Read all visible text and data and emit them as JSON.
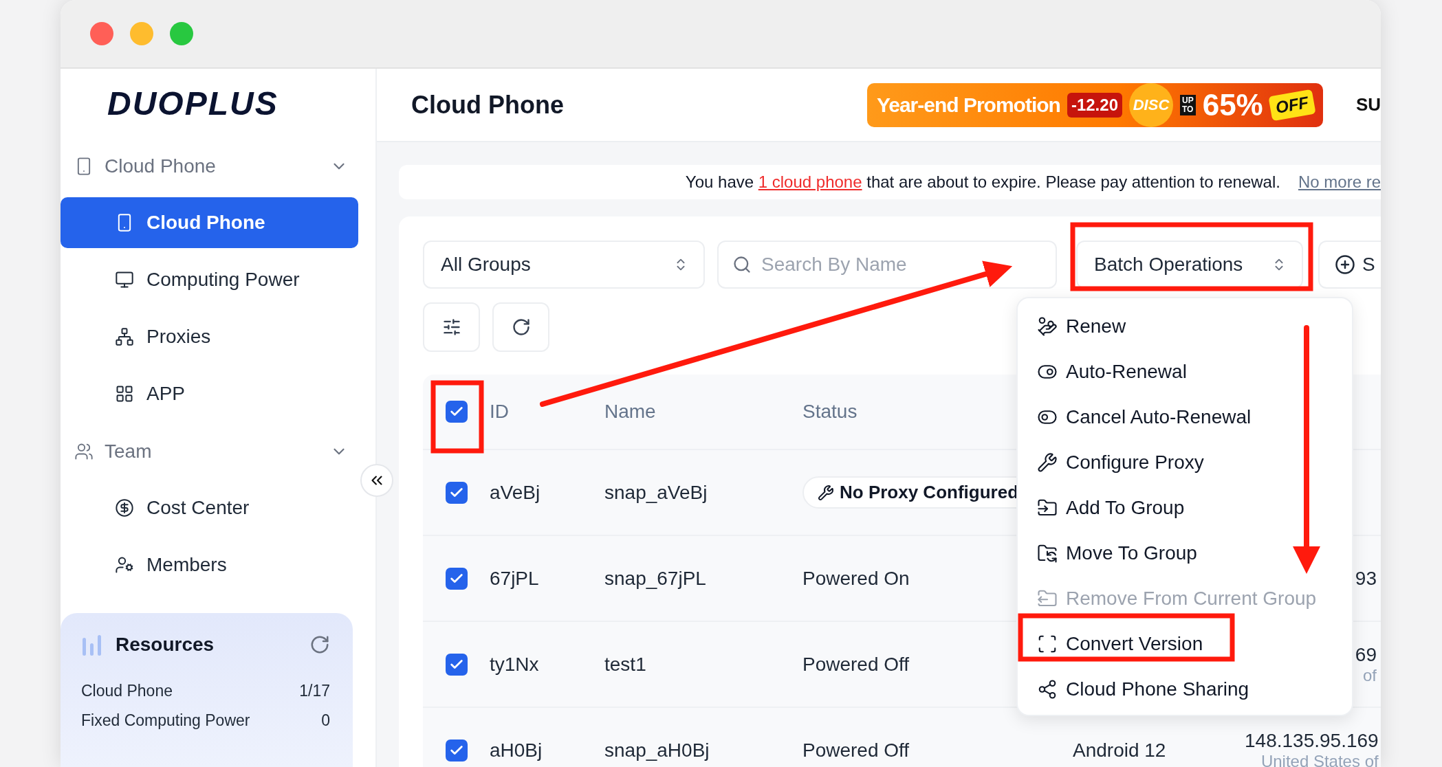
{
  "logo": "DUOPLUS",
  "sidebar": {
    "groups": [
      {
        "label": "Cloud Phone",
        "expanded": true,
        "children": [
          {
            "label": "Cloud Phone",
            "selected": true
          },
          {
            "label": "Computing Power",
            "selected": false
          },
          {
            "label": "Proxies",
            "selected": false
          },
          {
            "label": "APP",
            "selected": false
          }
        ]
      },
      {
        "label": "Team",
        "expanded": true,
        "children": [
          {
            "label": "Cost Center",
            "selected": false
          },
          {
            "label": "Members",
            "selected": false
          }
        ]
      }
    ],
    "resources": {
      "title": "Resources",
      "rows": [
        {
          "label": "Cloud Phone",
          "value": "1/17"
        },
        {
          "label": "Fixed Computing Power",
          "value": "0"
        }
      ]
    }
  },
  "header": {
    "title": "Cloud Phone",
    "promo": {
      "title": "Year-end Promotion",
      "date": "-12.20",
      "badge": "DISC",
      "up": "UP",
      "to": "TO",
      "percent": "65%",
      "off": "OFF"
    },
    "user": "SU"
  },
  "notice": {
    "before": "You have",
    "link": "1 cloud phone",
    "after": "that are about to expire. Please pay attention to renewal.",
    "dismiss": "No more re"
  },
  "toolbar": {
    "group_select": "All Groups",
    "search": {
      "placeholder": "Search By Name"
    },
    "batch": "Batch Operations",
    "add": "S"
  },
  "table": {
    "columns": [
      "ID",
      "Name",
      "Status"
    ],
    "all_checked": true,
    "rows": [
      {
        "checked": true,
        "id": "aVeBj",
        "name": "snap_aVeBj",
        "status": {
          "kind": "pill",
          "text": "No Proxy Configured"
        }
      },
      {
        "checked": true,
        "id": "67jPL",
        "name": "snap_67jPL",
        "status": {
          "kind": "text",
          "text": "Powered On"
        },
        "column_5": {
          "main": "93"
        }
      },
      {
        "checked": true,
        "id": "ty1Nx",
        "name": "test1",
        "status": {
          "kind": "text",
          "text": "Powered Off"
        },
        "column_5": {
          "main": "69",
          "sub": "of"
        }
      },
      {
        "checked": true,
        "id": "aH0Bj",
        "name": "snap_aH0Bj",
        "status": {
          "kind": "text",
          "text": "Powered Off"
        },
        "column_4": "Android 12",
        "column_5": {
          "main": "148.135.95.169",
          "sub": "United States of"
        }
      }
    ]
  },
  "batch_menu": [
    {
      "label": "Renew",
      "disabled": false
    },
    {
      "label": "Auto-Renewal",
      "disabled": false
    },
    {
      "label": "Cancel Auto-Renewal",
      "disabled": false
    },
    {
      "label": "Configure Proxy",
      "disabled": false
    },
    {
      "label": "Add To Group",
      "disabled": false
    },
    {
      "label": "Move To Group",
      "disabled": false
    },
    {
      "label": "Remove From Current Group",
      "disabled": true
    },
    {
      "label": "Convert Version",
      "disabled": false
    },
    {
      "label": "Cloud Phone Sharing",
      "disabled": false
    }
  ]
}
